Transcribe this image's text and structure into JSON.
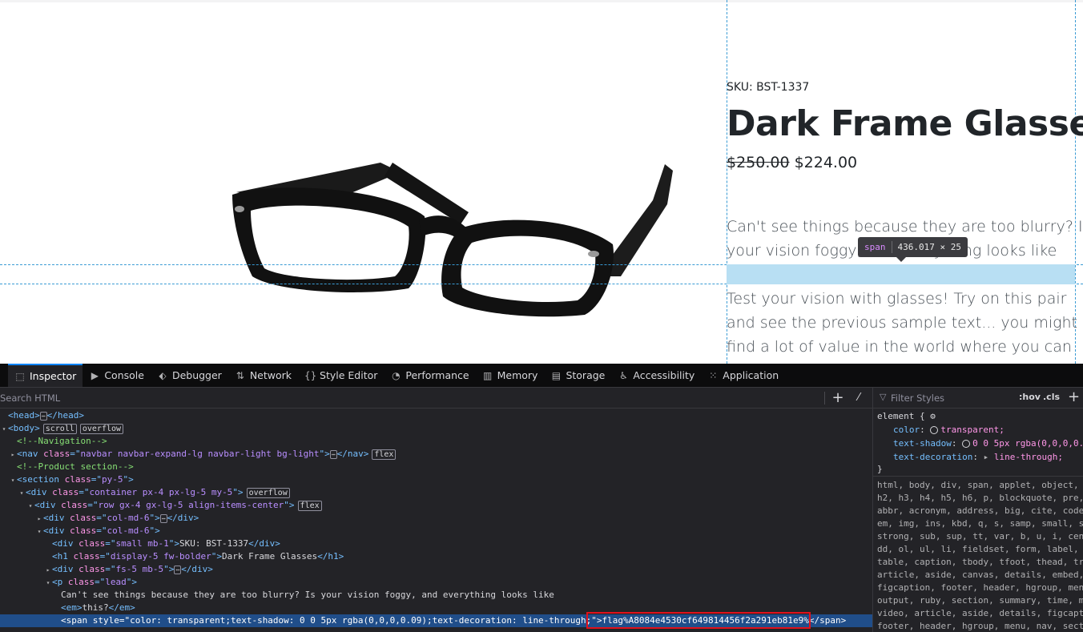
{
  "page": {
    "sku": "SKU: BST-1337",
    "title": "Dark Frame Glasses",
    "old_price": "$250.00",
    "new_price": "$224.00",
    "lead1": "Can't see things because they are too blurry? Is your vision foggy, and everything looks like",
    "lead2": "Test your vision with glasses! Try on this pair and see the previous sample text... you might find a lot of value in the world where you can see clearly!"
  },
  "tooltip": {
    "tag": "span",
    "size": "436.017 × 25"
  },
  "devtools": {
    "tabs": [
      {
        "label": "Inspector",
        "icon": "inspector-icon",
        "glyph": "⬚"
      },
      {
        "label": "Console",
        "icon": "console-icon",
        "glyph": "▶"
      },
      {
        "label": "Debugger",
        "icon": "debugger-icon",
        "glyph": "⬖"
      },
      {
        "label": "Network",
        "icon": "network-icon",
        "glyph": "⇅"
      },
      {
        "label": "Style Editor",
        "icon": "style-editor-icon",
        "glyph": "{}"
      },
      {
        "label": "Performance",
        "icon": "performance-icon",
        "glyph": "◔"
      },
      {
        "label": "Memory",
        "icon": "memory-icon",
        "glyph": "▥"
      },
      {
        "label": "Storage",
        "icon": "storage-icon",
        "glyph": "▤"
      },
      {
        "label": "Accessibility",
        "icon": "accessibility-icon",
        "glyph": "♿"
      },
      {
        "label": "Application",
        "icon": "application-icon",
        "glyph": "⁙"
      }
    ],
    "search_placeholder": "Search HTML",
    "filter_placeholder": "Filter Styles",
    "hov": ":hov",
    "cls": ".cls",
    "tree": [
      {
        "indent": 0,
        "tw": "",
        "parts": [
          [
            "tg",
            "<head>"
          ],
          [
            "dots",
            "⋯"
          ],
          [
            "tg",
            "</head>"
          ]
        ]
      },
      {
        "indent": 0,
        "tw": "▾",
        "parts": [
          [
            "tg",
            "<body>"
          ],
          [
            "badge",
            "scroll"
          ],
          [
            "badge",
            "overflow"
          ]
        ]
      },
      {
        "indent": 1,
        "tw": "",
        "parts": [
          [
            "cm",
            "<!--Navigation-->"
          ]
        ]
      },
      {
        "indent": 1,
        "tw": "▸",
        "parts": [
          [
            "tg",
            "<nav "
          ],
          [
            "at",
            "class"
          ],
          [
            "tg",
            "=\""
          ],
          [
            "av",
            "navbar navbar-expand-lg navbar-light bg-light"
          ],
          [
            "tg",
            "\">"
          ],
          [
            "dots",
            "⋯"
          ],
          [
            "tg",
            "</nav>"
          ],
          [
            "badge",
            "flex"
          ]
        ]
      },
      {
        "indent": 1,
        "tw": "",
        "parts": [
          [
            "cm",
            "<!--Product section-->"
          ]
        ]
      },
      {
        "indent": 1,
        "tw": "▾",
        "parts": [
          [
            "tg",
            "<section "
          ],
          [
            "at",
            "class"
          ],
          [
            "tg",
            "=\""
          ],
          [
            "av",
            "py-5"
          ],
          [
            "tg",
            "\">"
          ]
        ]
      },
      {
        "indent": 2,
        "tw": "▾",
        "parts": [
          [
            "tg",
            "<div "
          ],
          [
            "at",
            "class"
          ],
          [
            "tg",
            "=\""
          ],
          [
            "av",
            "container px-4 px-lg-5 my-5"
          ],
          [
            "tg",
            "\">"
          ],
          [
            "badge",
            "overflow"
          ]
        ]
      },
      {
        "indent": 3,
        "tw": "▾",
        "parts": [
          [
            "tg",
            "<div "
          ],
          [
            "at",
            "class"
          ],
          [
            "tg",
            "=\""
          ],
          [
            "av",
            "row gx-4 gx-lg-5 align-items-center"
          ],
          [
            "tg",
            "\">"
          ],
          [
            "badge",
            "flex"
          ]
        ]
      },
      {
        "indent": 4,
        "tw": "▸",
        "parts": [
          [
            "tg",
            "<div "
          ],
          [
            "at",
            "class"
          ],
          [
            "tg",
            "=\""
          ],
          [
            "av",
            "col-md-6"
          ],
          [
            "tg",
            "\">"
          ],
          [
            "dots",
            "⋯"
          ],
          [
            "tg",
            "</div>"
          ]
        ]
      },
      {
        "indent": 4,
        "tw": "▾",
        "parts": [
          [
            "tg",
            "<div "
          ],
          [
            "at",
            "class"
          ],
          [
            "tg",
            "=\""
          ],
          [
            "av",
            "col-md-6"
          ],
          [
            "tg",
            "\">"
          ]
        ]
      },
      {
        "indent": 5,
        "tw": "",
        "parts": [
          [
            "tg",
            "<div "
          ],
          [
            "at",
            "class"
          ],
          [
            "tg",
            "=\""
          ],
          [
            "av",
            "small mb-1"
          ],
          [
            "tg",
            "\">"
          ],
          [
            "tx",
            "SKU: BST-1337"
          ],
          [
            "tg",
            "</div>"
          ]
        ]
      },
      {
        "indent": 5,
        "tw": "",
        "parts": [
          [
            "tg",
            "<h1 "
          ],
          [
            "at",
            "class"
          ],
          [
            "tg",
            "=\""
          ],
          [
            "av",
            "display-5 fw-bolder"
          ],
          [
            "tg",
            "\">"
          ],
          [
            "tx",
            "Dark Frame Glasses"
          ],
          [
            "tg",
            "</h1>"
          ]
        ]
      },
      {
        "indent": 5,
        "tw": "▸",
        "parts": [
          [
            "tg",
            "<div "
          ],
          [
            "at",
            "class"
          ],
          [
            "tg",
            "=\""
          ],
          [
            "av",
            "fs-5 mb-5"
          ],
          [
            "tg",
            "\">"
          ],
          [
            "dots",
            "⋯"
          ],
          [
            "tg",
            "</div>"
          ]
        ]
      },
      {
        "indent": 5,
        "tw": "▾",
        "parts": [
          [
            "tg",
            "<p "
          ],
          [
            "at",
            "class"
          ],
          [
            "tg",
            "=\""
          ],
          [
            "av",
            "lead"
          ],
          [
            "tg",
            "\">"
          ]
        ]
      },
      {
        "indent": 6,
        "tw": "",
        "parts": [
          [
            "tx",
            "Can't see things because they are too blurry? Is your vision foggy, and everything looks like"
          ]
        ]
      },
      {
        "indent": 6,
        "tw": "",
        "parts": [
          [
            "tg",
            "<em>"
          ],
          [
            "tx",
            "this?"
          ],
          [
            "tg",
            "</em>"
          ]
        ]
      },
      {
        "indent": 6,
        "tw": "",
        "sel": true,
        "parts": [
          [
            "tg",
            "<span "
          ],
          [
            "at",
            "style"
          ],
          [
            "tg",
            "=\""
          ],
          [
            "av",
            "color: transparent;text-shadow: 0 0 5px rgba(0,0,0,0.09);text-decoration: line-through;"
          ],
          [
            "tg",
            "\">"
          ],
          [
            "tx",
            "flag%A8084e4530cf649814456f2a291eb81e9%"
          ],
          [
            "tg",
            "</span>"
          ]
        ]
      }
    ],
    "rule": {
      "selector": "element {",
      "props": [
        {
          "name": "color",
          "value": "transparent;",
          "swatch": true
        },
        {
          "name": "text-shadow",
          "value": "0 0 5px rgba(0,0,0,0.09);",
          "swatch": true
        },
        {
          "name": "text-decoration",
          "value": "line-through;",
          "arrow": true
        }
      ],
      "close": "}"
    },
    "inherited": [
      "html, body, div, span, applet, object,",
      "h2, h3, h4, h5, h6, p, blockquote, pre,",
      "abbr, acronym, address, big, cite, code",
      "em, img, ins, kbd, q, s, samp, small, s",
      "strong, sub, sup, tt, var, b, u, i, cen",
      "dd, ol, ul, li, fieldset, form, label,",
      "table, caption, tbody, tfoot, thead, tr",
      "article, aside, canvas, details, embed,",
      "figcaption, footer, header, hgroup, men",
      "output, ruby, section, summary, time, m",
      "video, article, aside, details, figcapt",
      "footer, header, hgroup, menu, nav, sect"
    ]
  }
}
